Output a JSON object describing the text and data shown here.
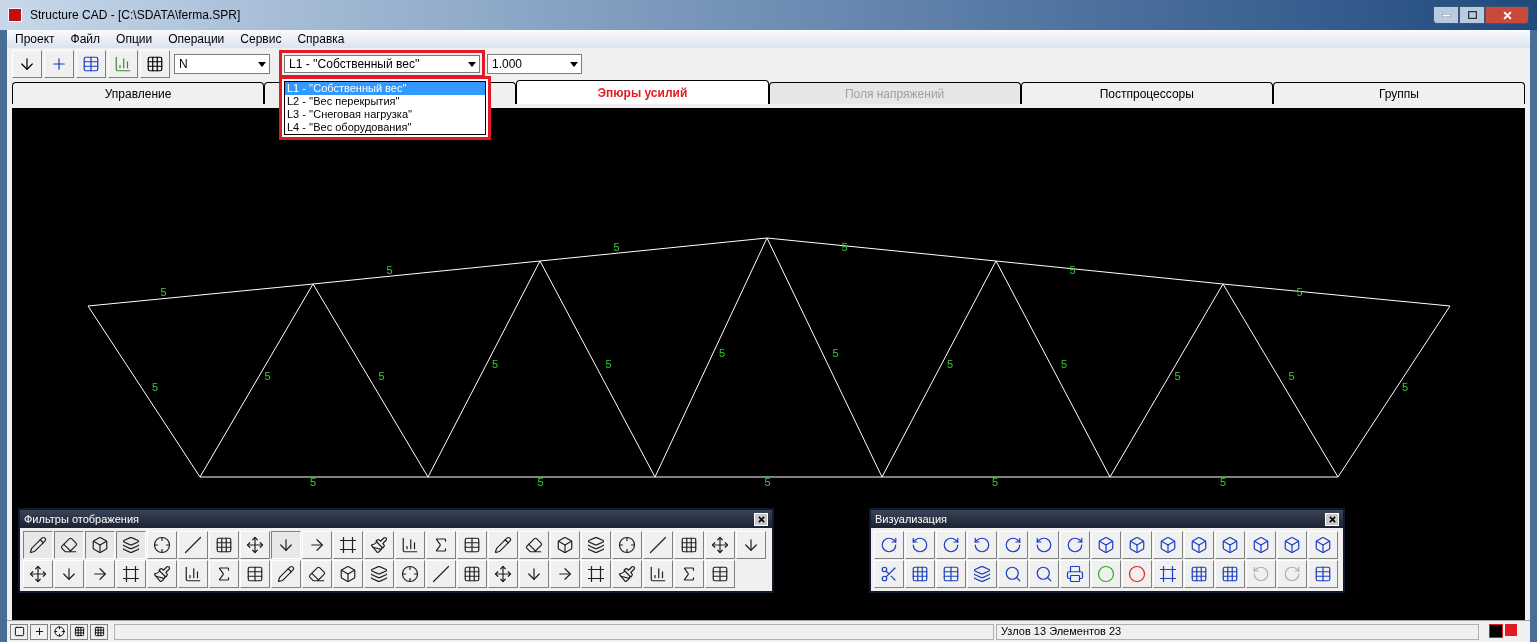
{
  "window": {
    "title": "Structure CAD  - [C:\\SDATA\\ferma.SPR]"
  },
  "menu": [
    "Проект",
    "Файл",
    "Опции",
    "Операции",
    "Сервис",
    "Справка"
  ],
  "toolbar": {
    "force_combo": {
      "value": "N"
    },
    "load_combo": {
      "value": "L1 - ''Собственный вес''",
      "expanded": true,
      "options": [
        {
          "label": "L1 - ''Собственный вес''",
          "selected": true
        },
        {
          "label": "L2 - ''Вес перекрытия''",
          "selected": false
        },
        {
          "label": "L3 - ''Снеговая нагрузка''",
          "selected": false
        },
        {
          "label": "L4 - ''Вес оборудования''",
          "selected": false
        }
      ]
    },
    "scale_combo": {
      "value": "1.000"
    }
  },
  "tabs": [
    {
      "label": "Управление",
      "selected": false,
      "disabled": false
    },
    {
      "selected": false
    },
    {
      "label": "Эпюры усилий",
      "selected": true,
      "disabled": false
    },
    {
      "label": "Поля напряжений",
      "selected": false,
      "disabled": true
    },
    {
      "label": "Постпроцессоры",
      "selected": false,
      "disabled": false
    },
    {
      "label": "Группы",
      "selected": false,
      "disabled": false
    }
  ],
  "truss": {
    "element_labels": [
      "5",
      "5",
      "5",
      "5",
      "5",
      "5",
      "5",
      "5",
      "5",
      "5",
      "5",
      "5",
      "5",
      "5",
      "5",
      "5",
      "5",
      "5",
      "5",
      "5",
      "5",
      "5",
      "5"
    ]
  },
  "filter_panel": {
    "title": "Фильтры отображения",
    "rows": [
      [
        {
          "pressed": true
        },
        {
          "pressed": true
        },
        {
          "pressed": true
        },
        {
          "pressed": true
        },
        {
          "pressed": false
        },
        {
          "pressed": false
        },
        {
          "pressed": false
        },
        {
          "pressed": false
        },
        {
          "pressed": true
        },
        {
          "pressed": false
        },
        {
          "pressed": false
        },
        {
          "pressed": false
        },
        {
          "pressed": false
        },
        {
          "pressed": false
        },
        {
          "pressed": false
        },
        {
          "pressed": false
        },
        {
          "pressed": false
        },
        {
          "pressed": false
        },
        {
          "pressed": false
        },
        {
          "pressed": false
        },
        {
          "pressed": false
        },
        {
          "pressed": false
        },
        {
          "pressed": false
        },
        {
          "pressed": false
        }
      ],
      [
        {
          "pressed": false
        },
        {
          "pressed": false
        },
        {
          "pressed": false
        },
        {
          "pressed": false
        },
        {
          "pressed": false
        },
        {
          "pressed": false
        },
        {
          "pressed": false
        },
        {
          "pressed": false
        },
        {
          "pressed": false
        },
        {
          "pressed": false
        },
        {
          "pressed": false
        },
        {
          "pressed": false
        },
        {
          "pressed": false
        },
        {
          "pressed": false
        },
        {
          "pressed": false
        },
        {
          "pressed": false
        },
        {
          "pressed": false
        },
        {
          "pressed": false
        },
        {
          "pressed": false
        },
        {
          "pressed": false
        },
        {
          "pressed": false
        },
        {
          "pressed": false
        },
        {
          "pressed": false
        }
      ]
    ]
  },
  "visual_panel": {
    "title": "Визуализация"
  },
  "status_bar": {
    "text": "Узлов 13 Элементов 23"
  }
}
